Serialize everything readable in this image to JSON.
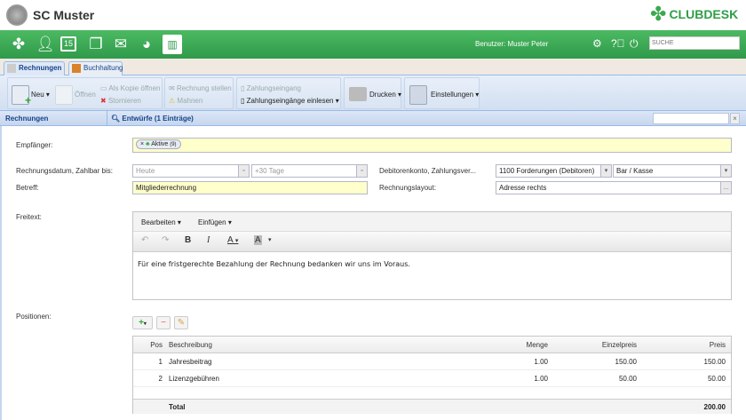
{
  "app": {
    "title": "SC Muster",
    "brand": "CLUBDESK",
    "brand_color": "#2f9e48"
  },
  "topbar": {
    "user_label": "Benutzer: Muster Peter",
    "search_placeholder": "SUCHE",
    "nav_icons": [
      "clover-icon",
      "person-icon",
      "calendar-icon",
      "documents-icon",
      "mail-icon",
      "globe-icon",
      "accounting-icon"
    ],
    "calendar_day": "15"
  },
  "tabs": [
    {
      "label": "Rechnungen",
      "active": true
    },
    {
      "label": "Buchhaltung",
      "active": false
    }
  ],
  "ribbon": {
    "new": "Neu",
    "open": "Öffnen",
    "copy": "Als Kopie öffnen",
    "cancel": "Stornieren",
    "issue": "Rechnung stellen",
    "remind": "Mahnen",
    "payment": "Zahlungseingang",
    "import": "Zahlungseingänge einlesen",
    "print": "Drucken",
    "settings": "Einstellungen"
  },
  "panel": {
    "left": "Rechnungen",
    "title": "Entwürfe (1 Einträge)",
    "close": "×"
  },
  "form": {
    "recipient_label": "Empfänger:",
    "recipient_tag": "Aktive",
    "recipient_count": "(9)",
    "date_label": "Rechnungsdatum, Zahlbar bis:",
    "date_placeholder": "Heute",
    "due_placeholder": "+30 Tage",
    "account_label": "Debitorenkonto, Zahlungsver...",
    "account_value": "1100 Forderungen (Debitoren)",
    "payment_value": "Bar / Kasse",
    "subject_label": "Betreff:",
    "subject_value": "Mitgliederrechnung",
    "layout_label": "Rechnungslayout:",
    "layout_value": "Adresse rechts",
    "freetext_label": "Freitext:",
    "editor_menu_edit": "Bearbeiten",
    "editor_menu_insert": "Einfügen",
    "freetext_value": "Für eine fristgerechte Bezahlung der Rechnung bedanken wir uns im Voraus.",
    "positions_label": "Positionen:"
  },
  "table": {
    "headers": {
      "pos": "Pos",
      "desc": "Beschreibung",
      "qty": "Menge",
      "unit": "Einzelpreis",
      "price": "Preis"
    },
    "rows": [
      {
        "pos": "1",
        "desc": "Jahresbeitrag",
        "qty": "1.00",
        "unit": "150.00",
        "price": "150.00"
      },
      {
        "pos": "2",
        "desc": "Lizenzgebühren",
        "qty": "1.00",
        "unit": "50.00",
        "price": "50.00"
      }
    ],
    "total_label": "Total",
    "total_value": "200.00"
  }
}
